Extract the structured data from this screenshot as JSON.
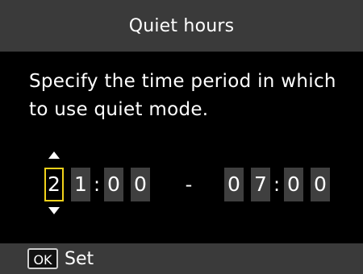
{
  "title": "Quiet hours",
  "instruction": "Specify the time period in which to use quiet mode.",
  "time": {
    "start": {
      "h1": "2",
      "h2": "1",
      "m1": "0",
      "m2": "0"
    },
    "separator": ":",
    "range_dash": "-",
    "end": {
      "h1": "0",
      "h2": "7",
      "m1": "0",
      "m2": "0"
    }
  },
  "footer": {
    "ok_key": "OK",
    "action": "Set"
  },
  "colors": {
    "selection": "#f2d21a",
    "bar_bg": "#3a3a3a",
    "digit_bg": "#3f3f3f"
  }
}
